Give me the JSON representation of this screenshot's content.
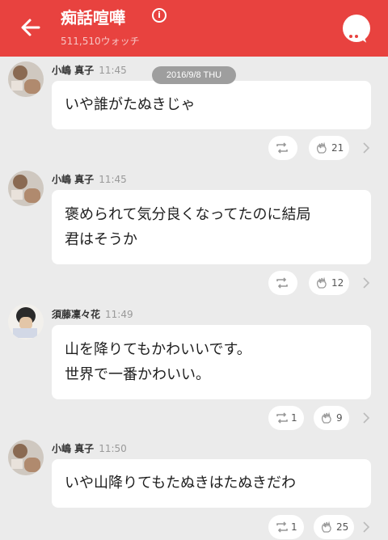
{
  "header": {
    "title": "痴話喧嘩",
    "watch_count": "511,510ウォッチ",
    "info_icon": "info-icon",
    "back_icon": "arrow-left-icon",
    "chat_icon": "chat-bubble-icon",
    "color": "#e8423f"
  },
  "date_separator": "2016/9/8 THU",
  "messages": [
    {
      "author": "小嶋 真子",
      "time": "11:45",
      "lines": [
        "いや誰がたぬきじゃ"
      ],
      "repost_count": "",
      "clap_count": "21"
    },
    {
      "author": "小嶋 真子",
      "time": "11:45",
      "lines": [
        "褒められて気分良くなってたのに結局",
        "君はそうか"
      ],
      "repost_count": "",
      "clap_count": "12"
    },
    {
      "author": "須藤凜々花",
      "time": "11:49",
      "lines": [
        "山を降りてもかわいいです。",
        "世界で一番かわいい。"
      ],
      "repost_count": "1",
      "clap_count": "9"
    },
    {
      "author": "小嶋 真子",
      "time": "11:50",
      "lines": [
        "いや山降りてもたぬきはたぬきだわ"
      ],
      "repost_count": "1",
      "clap_count": "25"
    }
  ]
}
